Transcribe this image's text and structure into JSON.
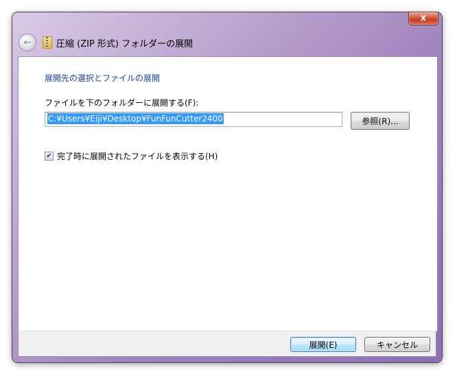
{
  "window": {
    "title": "圧縮 (ZIP 形式) フォルダーの展開",
    "close_glyph": "x"
  },
  "content": {
    "heading": "展開先の選択とファイルの展開",
    "field_label": "ファイルを下のフォルダーに展開する(F):",
    "path_value": "C:¥Users¥Eiji¥Desktop¥FunFunCutter2400",
    "browse_label": "参照(R)...",
    "checkbox_label": "完了時に展開されたファイルを表示する(H)",
    "checkbox_checked": true
  },
  "footer": {
    "ok_label": "展開(E)",
    "cancel_label": "キャンセル"
  },
  "colors": {
    "accent_heading": "#1e3e9a",
    "selection": "#3399ff",
    "frame": "#a083bd"
  },
  "icons": {
    "back": "back-arrow-icon",
    "title": "zip-folder-icon",
    "close": "close-icon",
    "check": "checkmark-icon"
  }
}
